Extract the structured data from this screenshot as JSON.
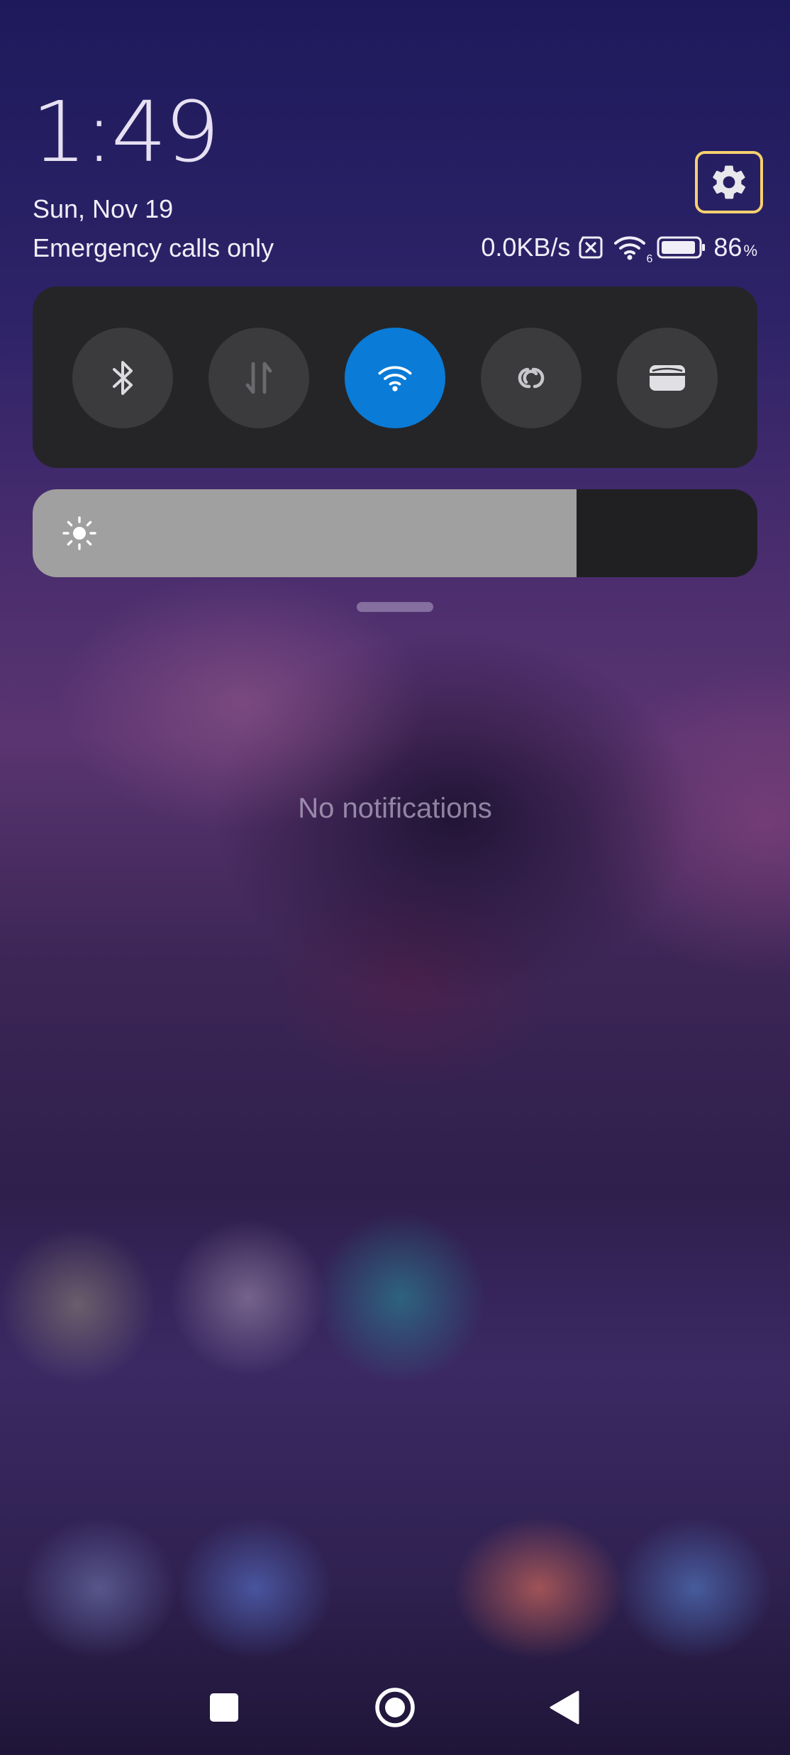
{
  "status": {
    "time": "1:49",
    "date": "Sun, Nov 19",
    "carrier": "Emergency calls only",
    "network_speed": "0.0KB/s",
    "wifi_badge": "6",
    "battery_percent": "86",
    "percent_sign": "%"
  },
  "quick_toggles": [
    {
      "name": "bluetooth",
      "icon": "bluetooth-icon",
      "active": false
    },
    {
      "name": "mobile-data",
      "icon": "data-arrows-icon",
      "active": false
    },
    {
      "name": "wifi",
      "icon": "wifi-icon",
      "active": true
    },
    {
      "name": "link",
      "icon": "link-icon",
      "active": false
    },
    {
      "name": "wallet",
      "icon": "card-icon",
      "active": false
    }
  ],
  "brightness": {
    "level": 0.75,
    "icon": "sun-icon"
  },
  "notifications": {
    "empty_text": "No notifications"
  },
  "navbar": {
    "buttons": [
      "recents-square-icon",
      "home-circle-icon",
      "back-triangle-icon"
    ]
  },
  "colors": {
    "active_toggle": "#0a7bd6",
    "panel": "#252528",
    "highlight_border": "#f6d070"
  }
}
